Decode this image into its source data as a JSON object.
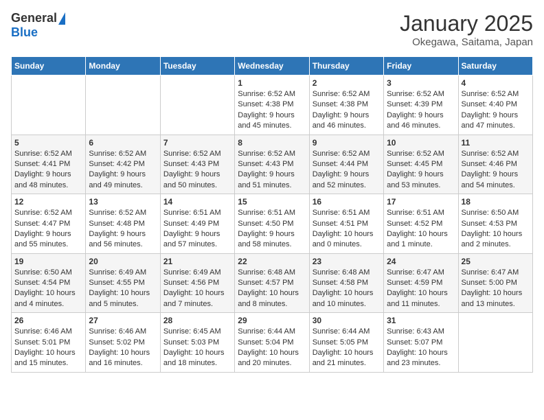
{
  "header": {
    "logo_general": "General",
    "logo_blue": "Blue",
    "month_title": "January 2025",
    "location": "Okegawa, Saitama, Japan"
  },
  "weekdays": [
    "Sunday",
    "Monday",
    "Tuesday",
    "Wednesday",
    "Thursday",
    "Friday",
    "Saturday"
  ],
  "weeks": [
    [
      {
        "day": "",
        "info": ""
      },
      {
        "day": "",
        "info": ""
      },
      {
        "day": "",
        "info": ""
      },
      {
        "day": "1",
        "info": "Sunrise: 6:52 AM\nSunset: 4:38 PM\nDaylight: 9 hours\nand 45 minutes."
      },
      {
        "day": "2",
        "info": "Sunrise: 6:52 AM\nSunset: 4:38 PM\nDaylight: 9 hours\nand 46 minutes."
      },
      {
        "day": "3",
        "info": "Sunrise: 6:52 AM\nSunset: 4:39 PM\nDaylight: 9 hours\nand 46 minutes."
      },
      {
        "day": "4",
        "info": "Sunrise: 6:52 AM\nSunset: 4:40 PM\nDaylight: 9 hours\nand 47 minutes."
      }
    ],
    [
      {
        "day": "5",
        "info": "Sunrise: 6:52 AM\nSunset: 4:41 PM\nDaylight: 9 hours\nand 48 minutes."
      },
      {
        "day": "6",
        "info": "Sunrise: 6:52 AM\nSunset: 4:42 PM\nDaylight: 9 hours\nand 49 minutes."
      },
      {
        "day": "7",
        "info": "Sunrise: 6:52 AM\nSunset: 4:43 PM\nDaylight: 9 hours\nand 50 minutes."
      },
      {
        "day": "8",
        "info": "Sunrise: 6:52 AM\nSunset: 4:43 PM\nDaylight: 9 hours\nand 51 minutes."
      },
      {
        "day": "9",
        "info": "Sunrise: 6:52 AM\nSunset: 4:44 PM\nDaylight: 9 hours\nand 52 minutes."
      },
      {
        "day": "10",
        "info": "Sunrise: 6:52 AM\nSunset: 4:45 PM\nDaylight: 9 hours\nand 53 minutes."
      },
      {
        "day": "11",
        "info": "Sunrise: 6:52 AM\nSunset: 4:46 PM\nDaylight: 9 hours\nand 54 minutes."
      }
    ],
    [
      {
        "day": "12",
        "info": "Sunrise: 6:52 AM\nSunset: 4:47 PM\nDaylight: 9 hours\nand 55 minutes."
      },
      {
        "day": "13",
        "info": "Sunrise: 6:52 AM\nSunset: 4:48 PM\nDaylight: 9 hours\nand 56 minutes."
      },
      {
        "day": "14",
        "info": "Sunrise: 6:51 AM\nSunset: 4:49 PM\nDaylight: 9 hours\nand 57 minutes."
      },
      {
        "day": "15",
        "info": "Sunrise: 6:51 AM\nSunset: 4:50 PM\nDaylight: 9 hours\nand 58 minutes."
      },
      {
        "day": "16",
        "info": "Sunrise: 6:51 AM\nSunset: 4:51 PM\nDaylight: 10 hours\nand 0 minutes."
      },
      {
        "day": "17",
        "info": "Sunrise: 6:51 AM\nSunset: 4:52 PM\nDaylight: 10 hours\nand 1 minute."
      },
      {
        "day": "18",
        "info": "Sunrise: 6:50 AM\nSunset: 4:53 PM\nDaylight: 10 hours\nand 2 minutes."
      }
    ],
    [
      {
        "day": "19",
        "info": "Sunrise: 6:50 AM\nSunset: 4:54 PM\nDaylight: 10 hours\nand 4 minutes."
      },
      {
        "day": "20",
        "info": "Sunrise: 6:49 AM\nSunset: 4:55 PM\nDaylight: 10 hours\nand 5 minutes."
      },
      {
        "day": "21",
        "info": "Sunrise: 6:49 AM\nSunset: 4:56 PM\nDaylight: 10 hours\nand 7 minutes."
      },
      {
        "day": "22",
        "info": "Sunrise: 6:48 AM\nSunset: 4:57 PM\nDaylight: 10 hours\nand 8 minutes."
      },
      {
        "day": "23",
        "info": "Sunrise: 6:48 AM\nSunset: 4:58 PM\nDaylight: 10 hours\nand 10 minutes."
      },
      {
        "day": "24",
        "info": "Sunrise: 6:47 AM\nSunset: 4:59 PM\nDaylight: 10 hours\nand 11 minutes."
      },
      {
        "day": "25",
        "info": "Sunrise: 6:47 AM\nSunset: 5:00 PM\nDaylight: 10 hours\nand 13 minutes."
      }
    ],
    [
      {
        "day": "26",
        "info": "Sunrise: 6:46 AM\nSunset: 5:01 PM\nDaylight: 10 hours\nand 15 minutes."
      },
      {
        "day": "27",
        "info": "Sunrise: 6:46 AM\nSunset: 5:02 PM\nDaylight: 10 hours\nand 16 minutes."
      },
      {
        "day": "28",
        "info": "Sunrise: 6:45 AM\nSunset: 5:03 PM\nDaylight: 10 hours\nand 18 minutes."
      },
      {
        "day": "29",
        "info": "Sunrise: 6:44 AM\nSunset: 5:04 PM\nDaylight: 10 hours\nand 20 minutes."
      },
      {
        "day": "30",
        "info": "Sunrise: 6:44 AM\nSunset: 5:05 PM\nDaylight: 10 hours\nand 21 minutes."
      },
      {
        "day": "31",
        "info": "Sunrise: 6:43 AM\nSunset: 5:07 PM\nDaylight: 10 hours\nand 23 minutes."
      },
      {
        "day": "",
        "info": ""
      }
    ]
  ]
}
